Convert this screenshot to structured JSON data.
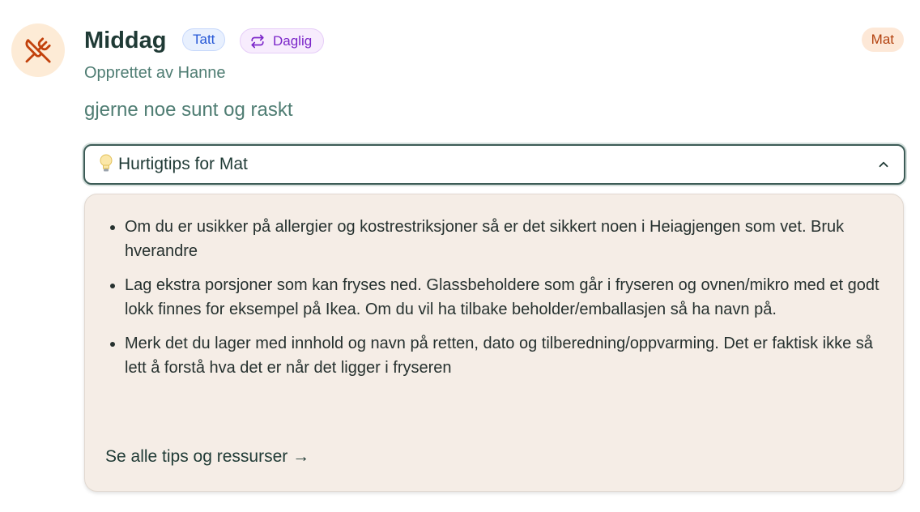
{
  "activity": {
    "title": "Middag",
    "status_badge": "Tatt",
    "frequency_badge": "Daglig",
    "category_badge": "Mat",
    "creator_text": "Opprettet av Hanne",
    "description": "gjerne noe sunt og raskt",
    "icon": "utensils-crossed-icon"
  },
  "tips": {
    "toggle_label": "Hurtigtips for Mat",
    "toggle_icon": "lightbulb-icon",
    "expanded": true,
    "items": [
      "Om du er usikker på allergier og kostrestriksjoner så er det sikkert noen i Heiagjengen som vet. Bruk hverandre",
      "Lag ekstra porsjoner som kan fryses ned. Glassbeholdere som går i fryseren og ovnen/mikro med et godt lokk finnes for eksempel på Ikea. Om du vil ha tilbake beholder/emballasjen så ha navn på.",
      "Merk det du lager med innhold og navn på retten, dato og tilberedning/oppvarming. Det er faktisk ikke så lett å forstå hva det er når det ligger i fryseren"
    ],
    "link_label": "Se alle tips og ressurser →"
  },
  "colors": {
    "category_accent": "#b3420f",
    "category_bg": "#fde8d7",
    "status_accent": "#2557d6",
    "frequency_accent": "#7b26c9",
    "panel_bg": "#f5ede6",
    "text_muted": "#4f7d73"
  }
}
